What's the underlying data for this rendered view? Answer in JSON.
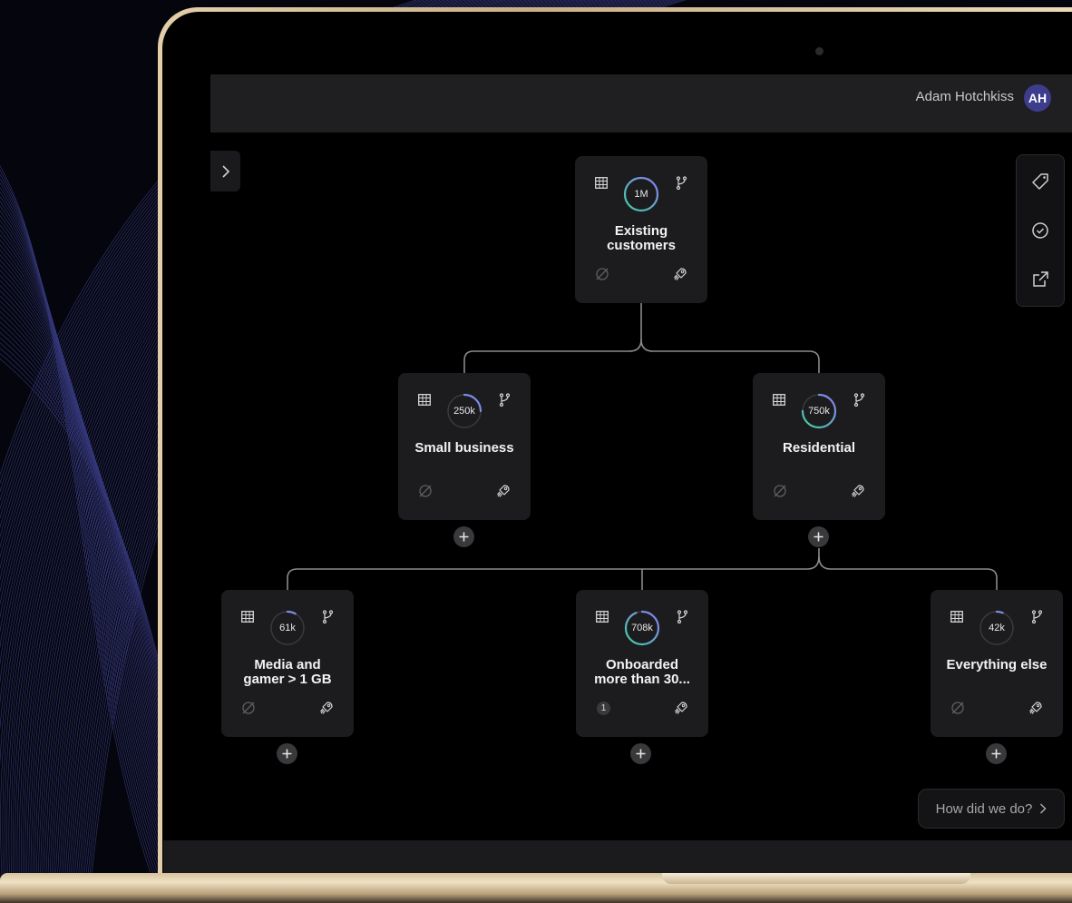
{
  "header": {
    "user_name": "Adam Hotchkiss",
    "avatar_initials": "AH",
    "avatar_color": "#3d3c8d"
  },
  "sidebar_toggle": {
    "icon": "chevron-right-icon"
  },
  "right_panel": {
    "icons": [
      "tag-icon",
      "clock-check-icon",
      "external-link-icon"
    ]
  },
  "tree": {
    "nodes": [
      {
        "id": "existing",
        "count": "1M",
        "title_lines": [
          "Existing",
          "customers"
        ],
        "fill": 1.0,
        "badge": ""
      },
      {
        "id": "small-business",
        "count": "250k",
        "title_lines": [
          "Small business",
          ""
        ],
        "fill": 0.25,
        "badge": ""
      },
      {
        "id": "residential",
        "count": "750k",
        "title_lines": [
          "Residential",
          ""
        ],
        "fill": 0.75,
        "badge": ""
      },
      {
        "id": "media-gamer",
        "count": "61k",
        "title_lines": [
          "Media and",
          "gamer > 1 GB"
        ],
        "fill": 0.08,
        "badge": ""
      },
      {
        "id": "onboarded",
        "count": "708k",
        "title_lines": [
          "Onboarded",
          "more than 30..."
        ],
        "fill": 0.94,
        "badge": "1"
      },
      {
        "id": "everything-else",
        "count": "42k",
        "title_lines": [
          "Everything else",
          ""
        ],
        "fill": 0.06,
        "badge": ""
      }
    ]
  },
  "feedback": {
    "label": "How did we do?"
  },
  "colors": {
    "ring_start": "#3fd1a0",
    "ring_end": "#8b7cf6",
    "node_bg": "#1c1c1e",
    "line": "#8a8a8e"
  }
}
